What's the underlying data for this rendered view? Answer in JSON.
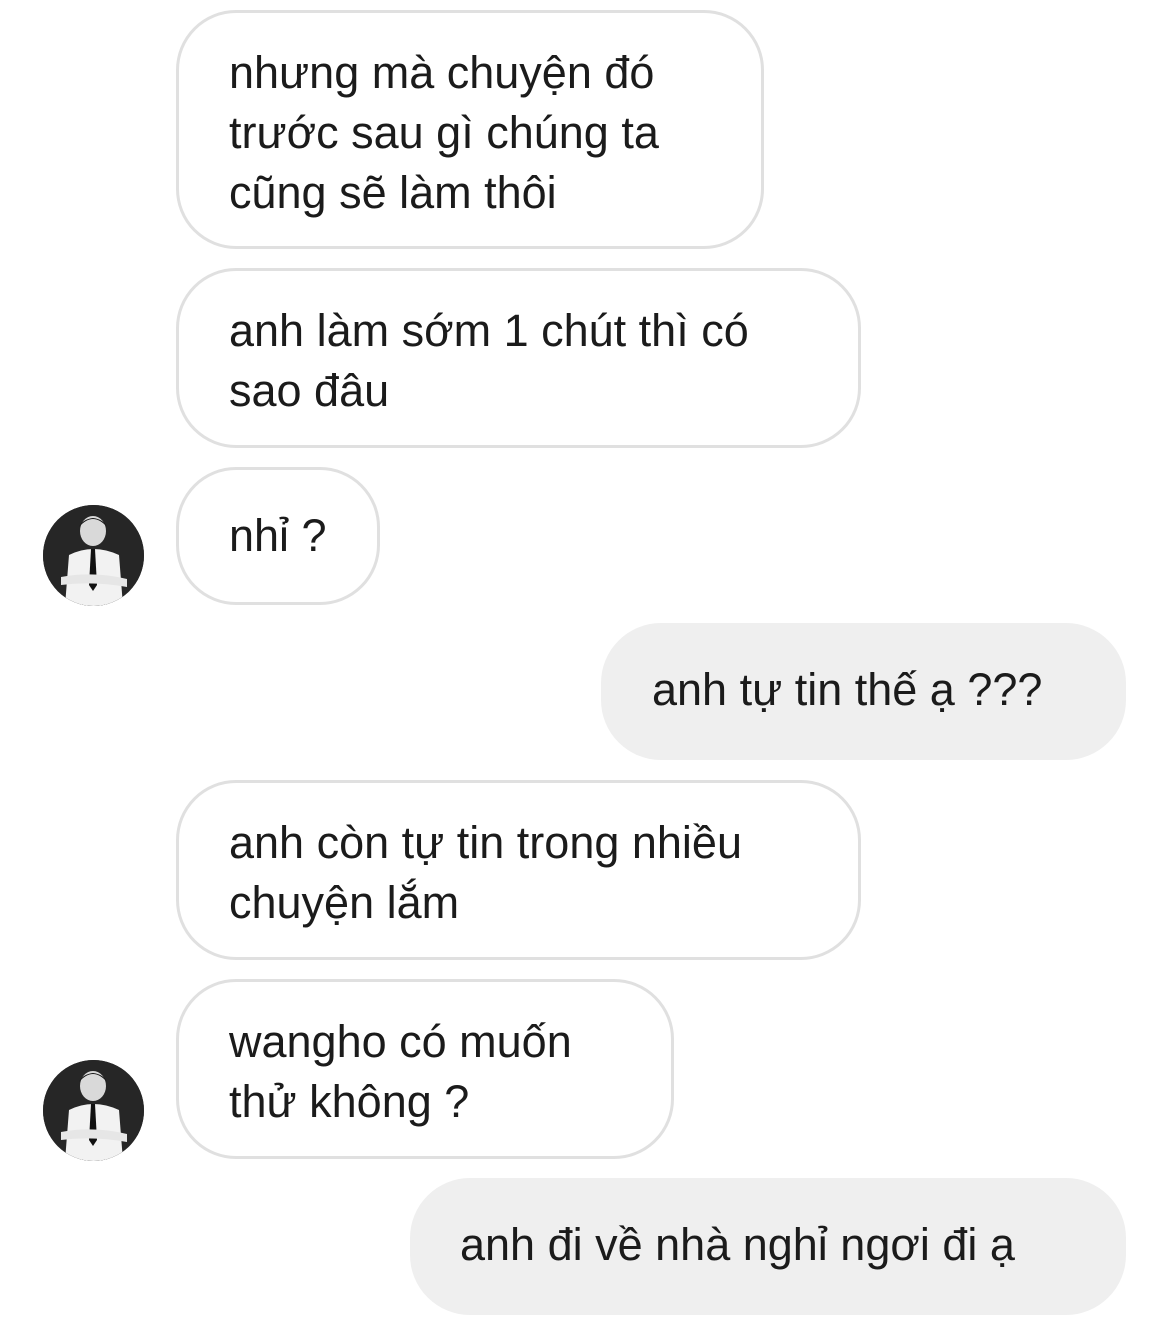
{
  "messages": [
    {
      "side": "in",
      "text": "nhưng mà chuyện đó\ntrước sau gì chúng ta\ncũng sẽ làm thôi",
      "avatar": false
    },
    {
      "side": "in",
      "text": "anh làm sớm 1 chút thì có\nsao đâu",
      "avatar": false
    },
    {
      "side": "in",
      "text": "nhỉ ?",
      "avatar": true
    },
    {
      "side": "out",
      "text": "anh tự tin thế ạ ???"
    },
    {
      "side": "in",
      "text": "anh còn tự tin trong nhiều\nchuyện lắm",
      "avatar": false
    },
    {
      "side": "in",
      "text": "wangho có muốn\nthử không ?",
      "avatar": true
    },
    {
      "side": "out",
      "text": "anh đi về nhà nghỉ ngơi đi ạ"
    }
  ],
  "colors": {
    "incoming_bubble_border": "#e0e0e0",
    "outgoing_bubble_bg": "#efefef",
    "text": "#1b1b1b"
  },
  "icons": {
    "avatar": "profile-photo-man-in-suit"
  }
}
